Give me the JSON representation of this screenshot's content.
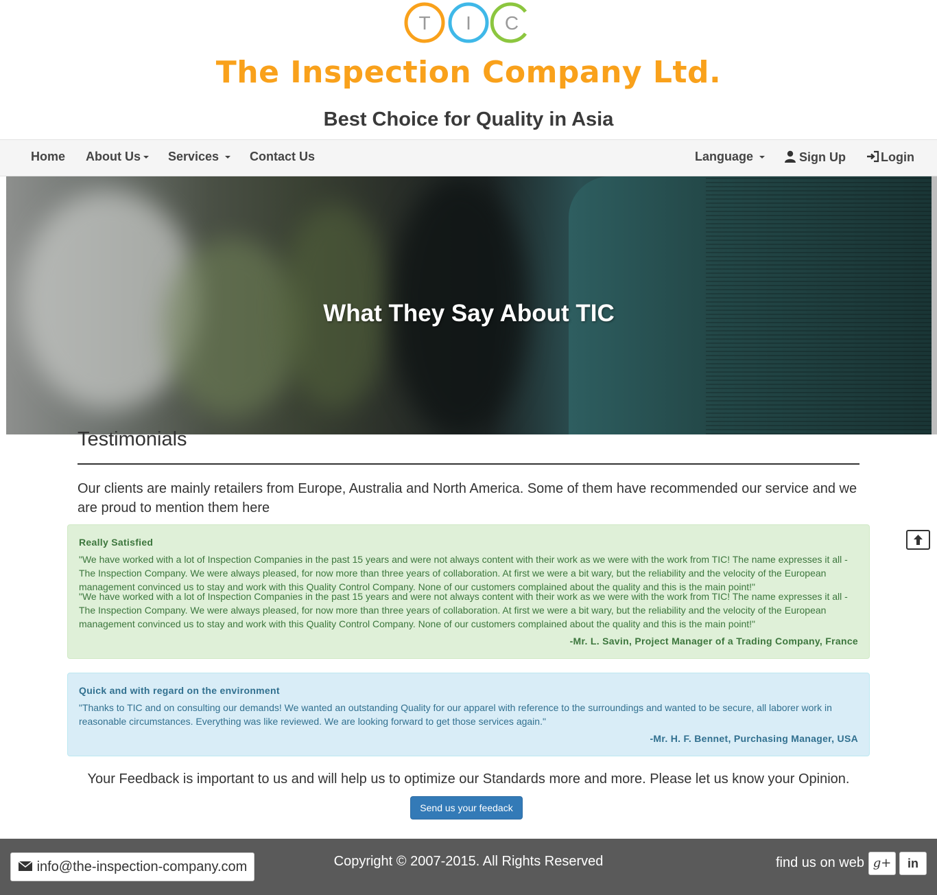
{
  "header": {
    "logo_letters": [
      "T",
      "I",
      "C"
    ],
    "company_name": "The Inspection Company Ltd.",
    "tagline": "Best Choice for Quality in Asia"
  },
  "nav": {
    "home": "Home",
    "about": "About Us",
    "services": "Services",
    "contact": "Contact Us",
    "language": "Language",
    "signup": "Sign Up",
    "login": "Login"
  },
  "hero": {
    "title": "What They Say About TIC"
  },
  "testimonials": {
    "heading": "Testimonials",
    "intro": "Our clients are mainly retailers from Europe, Australia and North America. Some of them have recommended our service and we are proud to mention them here",
    "items": [
      {
        "title": "Really Satisfied",
        "quote": "\"We have worked with a lot of Inspection Companies in the past 15 years and were not always content with their work as we were with the work from TIC! The name expresses it all - The Inspection Company. We were always pleased, for now more than three years of collaboration. At first we were a bit wary, but the reliability and the velocity of the European management convinced us to stay and work with this Quality Control Company. None of our customers complained about the quality and this is the main point!\"",
        "author": "-Mr. L. Savin, Project Manager of a Trading Company, France"
      },
      {
        "title": "Quick and with regard on the environment",
        "quote": "\"Thanks to TIC and on consulting our demands! We wanted an outstanding Quality for our apparel with reference to the surroundings and wanted to be secure, all laborer work in reasonable circumstances. Everything was like reviewed. We are looking forward to get those services again.\"",
        "author": "-Mr. H. F. Bennet, Purchasing Manager, USA"
      }
    ]
  },
  "feedback": {
    "text": "Your Feedback is important to us and will help us to optimize our Standards more and more. Please let us know your Opinion.",
    "button": "Send us your feedack"
  },
  "footer": {
    "email": "info@the-inspection-company.com",
    "copyright": "Copyright © 2007-2015. All Rights Reserved",
    "find_us": "find us on web",
    "social": [
      "g+",
      "in"
    ]
  },
  "colors": {
    "brand_orange": "#f9a11b",
    "logo_blue": "#3fb8e8",
    "logo_green": "#8cc63f",
    "success_bg": "#dff0d8",
    "info_bg": "#d9edf7",
    "button_blue": "#337ab7",
    "footer_bg": "#5a5a5a"
  },
  "icons": [
    "envelope-icon",
    "user-icon",
    "login-icon",
    "arrow-up-icon",
    "google-plus-icon",
    "linkedin-icon"
  ]
}
